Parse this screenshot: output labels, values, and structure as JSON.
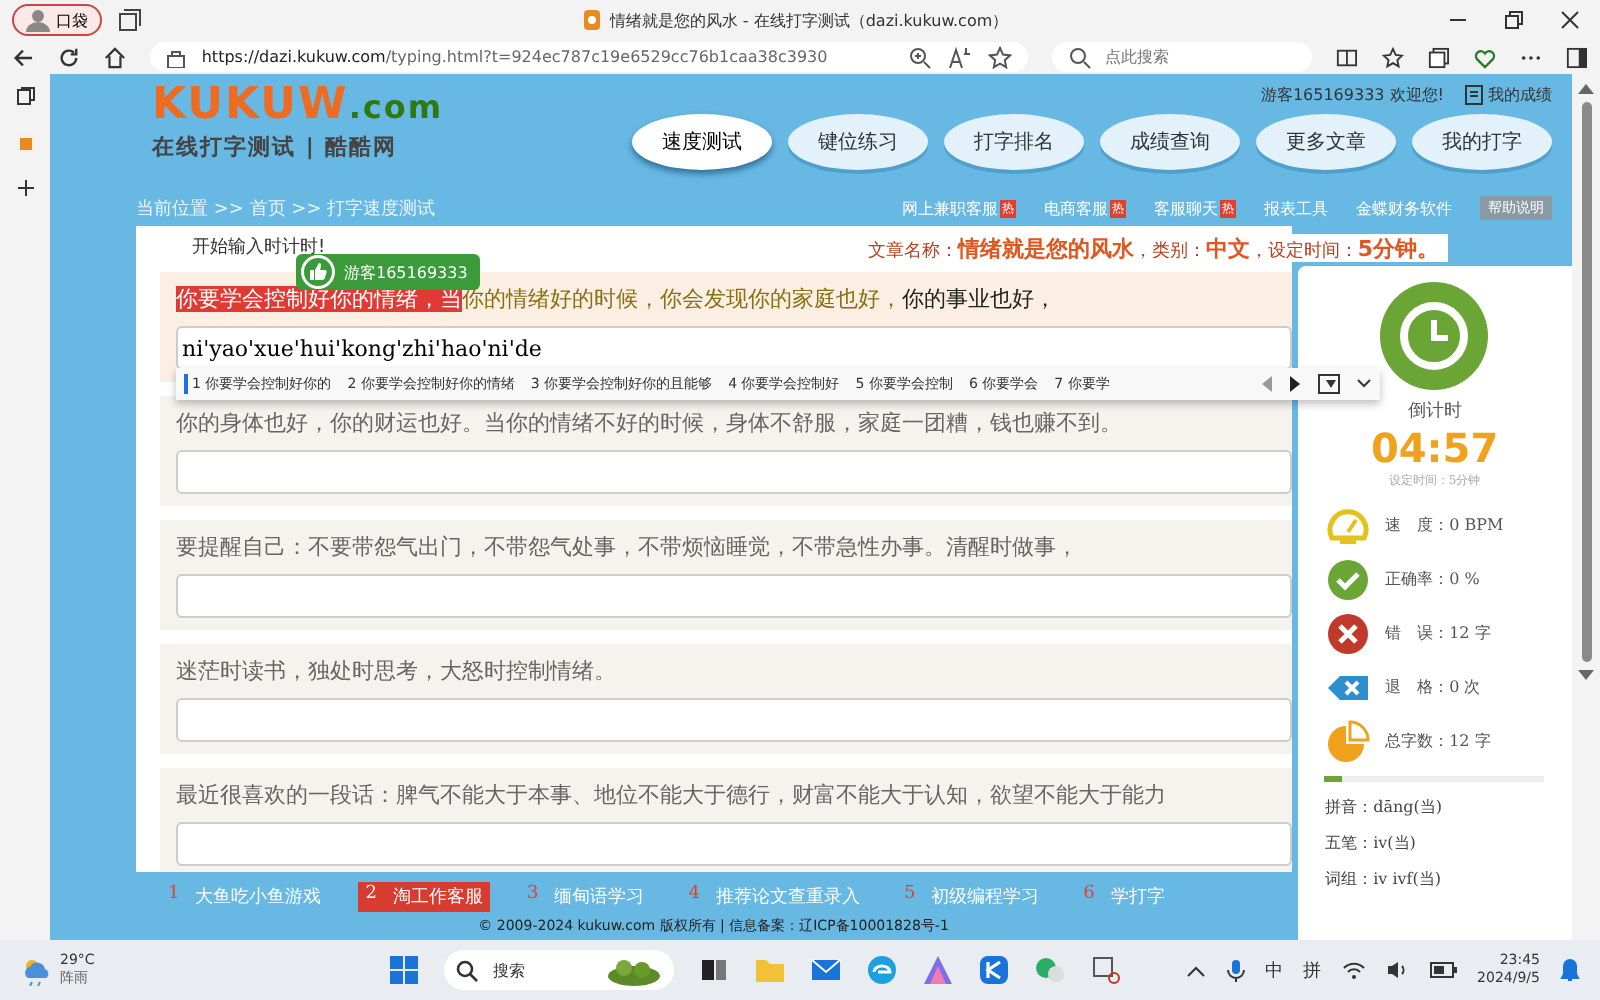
{
  "browser": {
    "profile": "口袋",
    "tab_title": "情绪就是您的风水 - 在线打字测试（dazi.kukuw.com）",
    "url_host": "https://dazi.kukuw.com",
    "url_path": "/typing.html?t=924ec787c19e6529cc76b1caa38c3930",
    "search_placeholder": "点此搜索"
  },
  "header": {
    "logo": "KUKUW",
    "logo_suffix": ".com",
    "tagline": "在线打字测试 | 酷酷网",
    "user": "游客165169333 欢迎您!",
    "my_scores": "我的成绩",
    "nav": [
      {
        "label": "速度测试",
        "selected": true
      },
      {
        "label": "键位练习",
        "selected": false
      },
      {
        "label": "打字排名",
        "selected": false
      },
      {
        "label": "成绩查询",
        "selected": false
      },
      {
        "label": "更多文章",
        "selected": false
      },
      {
        "label": "我的打字",
        "selected": false
      }
    ],
    "breadcrumb": "当前位置 >> 首页 >> 打字速度测试",
    "links": [
      {
        "label": "网上兼职客服",
        "hot": "热"
      },
      {
        "label": "电商客服",
        "hot": "热"
      },
      {
        "label": "客服聊天",
        "hot": "热"
      },
      {
        "label": "报表工具"
      },
      {
        "label": "金蝶财务软件"
      },
      {
        "label": "帮助说明",
        "kind": "button"
      }
    ]
  },
  "typing": {
    "hint": "开始输入时计时!",
    "badge": "游客165169333",
    "article_label": "文章名称：",
    "article": "情绪就是您的风水",
    "category_label": "，类别：",
    "category": "中文",
    "time_label": "，设定时间：",
    "time": "5分钟。",
    "lines": [
      {
        "segments": [
          {
            "text": "你要学会控制好你的情绪，当",
            "kind": "typed"
          },
          {
            "text": "你的情绪好的时候，你会发现你的家庭也好，",
            "kind": "current"
          },
          {
            "text": "你的事业也好，",
            "kind": "pending"
          }
        ],
        "input": "ni'yao'xue'hui'kong'zhi'hao'ni'de"
      },
      {
        "segments": [
          {
            "text": "你的身体也好，你的财运也好。当你的情绪不好的时候，身体不舒服，家庭一团糟，钱也赚不到。",
            "kind": "pending"
          }
        ]
      },
      {
        "segments": [
          {
            "text": "要提醒自己：不要带怨气出门，不带怨气处事，不带烦恼睡觉，不带急性办事。清醒时做事，",
            "kind": "pending"
          }
        ]
      },
      {
        "segments": [
          {
            "text": "迷茫时读书，独处时思考，大怒时控制情绪。",
            "kind": "pending"
          }
        ]
      },
      {
        "segments": [
          {
            "text": "最近很喜欢的一段话：脾气不能大于本事、地位不能大于德行，财富不能大于认知，欲望不能大于能力",
            "kind": "pending"
          }
        ]
      }
    ],
    "candidates": [
      {
        "label": "1 你要学会控制好你的",
        "selected": true
      },
      {
        "label": "2 你要学会控制好你的情绪",
        "selected": false
      },
      {
        "label": "3 你要学会控制好你的且能够",
        "selected": false
      },
      {
        "label": "4 你要学会控制好",
        "selected": false
      },
      {
        "label": "5 你要学会控制",
        "selected": false
      },
      {
        "label": "6 你要学会",
        "selected": false
      },
      {
        "label": "7 你要学",
        "selected": false
      }
    ]
  },
  "stats": {
    "countdown_label": "倒计时",
    "countdown": "04:57",
    "set_time": "设定时间：5分钟",
    "items": [
      {
        "kind": "speed",
        "text": "速　度：0 BPM"
      },
      {
        "kind": "accuracy",
        "text": "正确率：0 %"
      },
      {
        "kind": "error",
        "text": "错　误：12 字"
      },
      {
        "kind": "backspace",
        "text": "退　格：0 次"
      },
      {
        "kind": "total",
        "text": "总字数：12 字"
      }
    ],
    "progress": {
      "level": 0.08
    },
    "hints": [
      "拼音：dāng(当)",
      "五笔：iv(当)",
      "词组：iv ivf(当)"
    ]
  },
  "footer": {
    "tabs": [
      {
        "number": "1",
        "label": "大鱼吃小鱼游戏",
        "selected": false
      },
      {
        "number": "2",
        "label": "淘工作客服",
        "selected": true
      },
      {
        "number": "3",
        "label": "缅甸语学习",
        "selected": false
      },
      {
        "number": "4",
        "label": "推荐论文查重录入",
        "selected": false
      },
      {
        "number": "5",
        "label": "初级编程学习",
        "selected": false
      },
      {
        "number": "6",
        "label": "学打字",
        "selected": false
      }
    ],
    "copyright": "© 2009-2024 kukuw.com 版权所有 | 信息备案：辽ICP备10001828号-1"
  },
  "taskbar": {
    "temperature": "29°C",
    "weather": "阵雨",
    "search": "搜索",
    "ime": [
      "中",
      "拼"
    ],
    "time": "23:45",
    "date": "2024/9/5"
  }
}
